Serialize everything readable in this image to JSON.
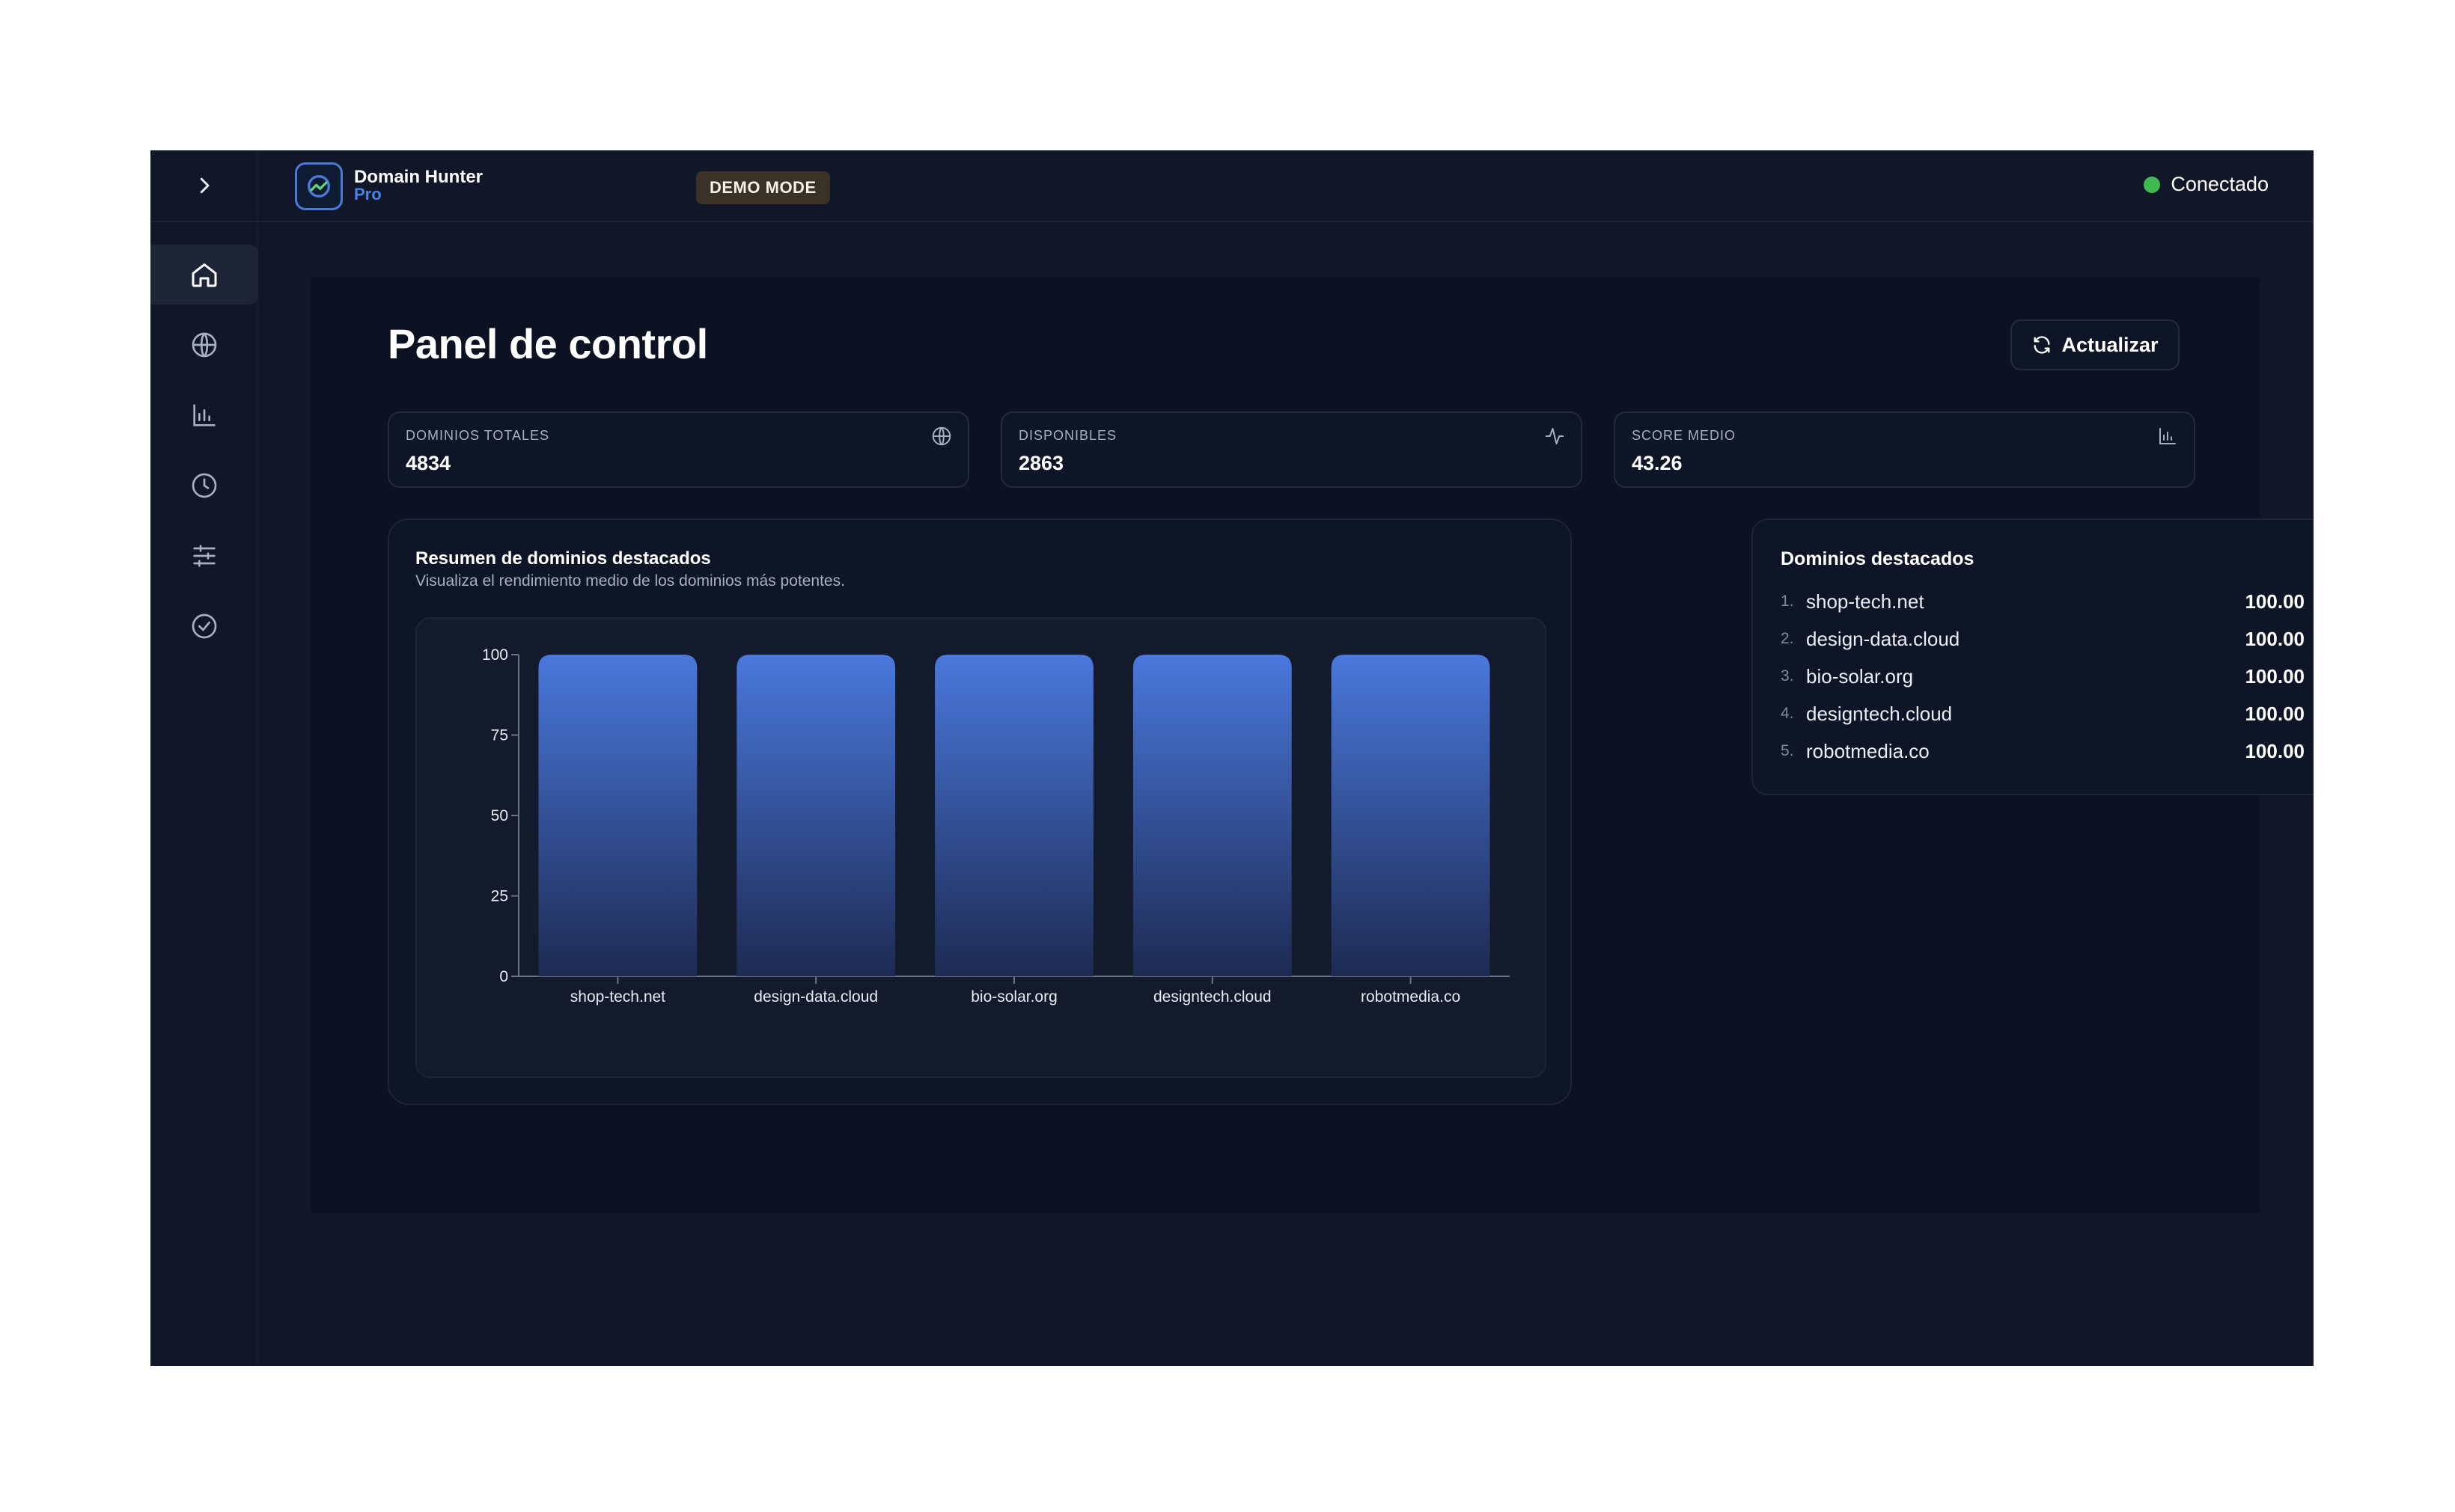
{
  "brand": {
    "name": "Domain Hunter",
    "tier": "Pro"
  },
  "topbar": {
    "demo_badge": "DEMO MODE",
    "status_label": "Conectado",
    "status_color": "#3fb950"
  },
  "sidebar": {
    "toggle_icon": "chevron-right-icon",
    "items": [
      {
        "icon": "home-icon",
        "active": true
      },
      {
        "icon": "globe-icon",
        "active": false
      },
      {
        "icon": "bar-chart-icon",
        "active": false
      },
      {
        "icon": "clock-icon",
        "active": false
      },
      {
        "icon": "sliders-icon",
        "active": false
      },
      {
        "icon": "check-circle-icon",
        "active": false
      }
    ]
  },
  "page": {
    "title": "Panel de control",
    "refresh_label": "Actualizar"
  },
  "stats": [
    {
      "label": "DOMINIOS TOTALES",
      "value": "4834",
      "icon": "globe-icon"
    },
    {
      "label": "DISPONIBLES",
      "value": "2863",
      "icon": "activity-icon"
    },
    {
      "label": "SCORE MEDIO",
      "value": "43.26",
      "icon": "bar-chart-icon"
    }
  ],
  "chart_card": {
    "title": "Resumen de dominios destacados",
    "subtitle": "Visualiza el rendimiento medio de los dominios más potentes."
  },
  "chart_data": {
    "type": "bar",
    "categories": [
      "shop-tech.net",
      "design-data.cloud",
      "bio-solar.org",
      "designtech.cloud",
      "robotmedia.co"
    ],
    "values": [
      100,
      100,
      100,
      100,
      100
    ],
    "ylim": [
      0,
      100
    ],
    "yticks": [
      0,
      25,
      50,
      75,
      100
    ],
    "bar_color_top": "#4a78dc",
    "bar_color_bottom": "#1d2a52"
  },
  "top_domains": {
    "title": "Dominios destacados",
    "items": [
      {
        "rank": "1.",
        "name": "shop-tech.net",
        "score": "100.00"
      },
      {
        "rank": "2.",
        "name": "design-data.cloud",
        "score": "100.00"
      },
      {
        "rank": "3.",
        "name": "bio-solar.org",
        "score": "100.00"
      },
      {
        "rank": "4.",
        "name": "designtech.cloud",
        "score": "100.00"
      },
      {
        "rank": "5.",
        "name": "robotmedia.co",
        "score": "100.00"
      }
    ]
  }
}
